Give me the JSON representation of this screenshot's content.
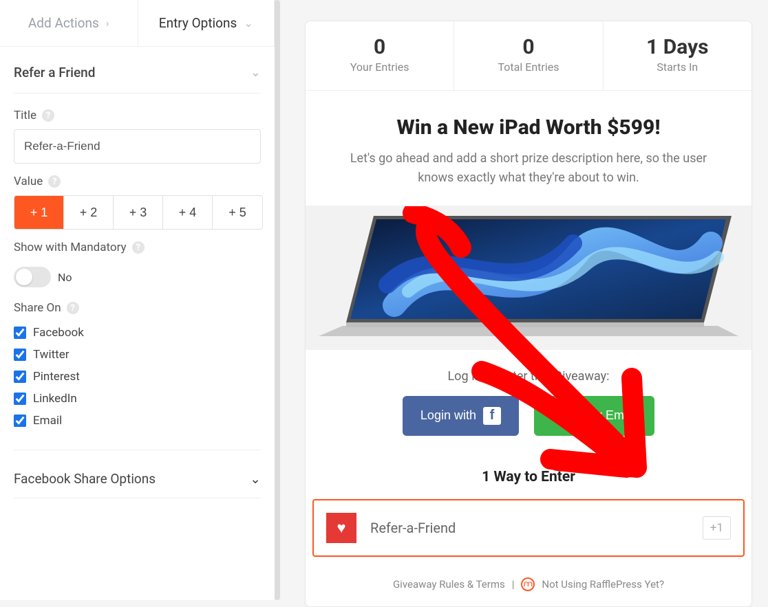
{
  "sidebar": {
    "tabs": {
      "add_actions": "Add Actions",
      "entry_options": "Entry Options"
    },
    "section_title": "Refer a Friend",
    "title": {
      "label": "Title",
      "value": "Refer-a-Friend"
    },
    "value": {
      "label": "Value",
      "options": [
        "+ 1",
        "+ 2",
        "+ 3",
        "+ 4",
        "+ 5"
      ],
      "selected_index": 0
    },
    "mandatory": {
      "label": "Show with Mandatory",
      "state_label": "No"
    },
    "share_on": {
      "label": "Share On",
      "items": [
        {
          "label": "Facebook",
          "checked": true
        },
        {
          "label": "Twitter",
          "checked": true
        },
        {
          "label": "Pinterest",
          "checked": true
        },
        {
          "label": "LinkedIn",
          "checked": true
        },
        {
          "label": "Email",
          "checked": true
        }
      ]
    },
    "facebook_share_options_label": "Facebook Share Options"
  },
  "preview": {
    "stats": [
      {
        "value": "0",
        "label": "Your Entries"
      },
      {
        "value": "0",
        "label": "Total Entries"
      },
      {
        "value": "1 Days",
        "label": "Starts In"
      }
    ],
    "headline": "Win a New iPad Worth $599!",
    "subline": "Let's go ahead and add a short prize description here, so the user knows exactly what they're about to win.",
    "login_label": "Log In to Enter this Giveaway:",
    "login_fb": "Login with",
    "login_email": "Use Your Email",
    "ways_title": "1 Way to Enter",
    "entry": {
      "label": "Refer-a-Friend",
      "plus": "+1"
    },
    "footer": {
      "rules": "Giveaway Rules & Terms",
      "sep": "|",
      "promo": "Not Using RafflePress Yet?"
    }
  }
}
